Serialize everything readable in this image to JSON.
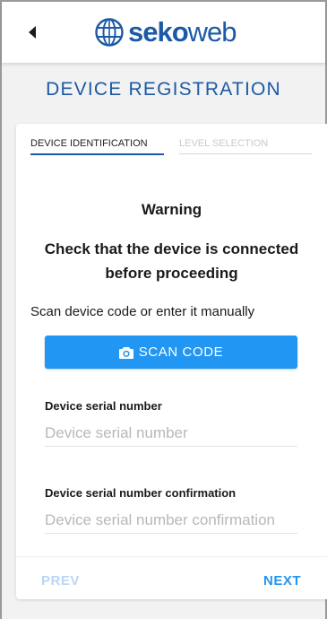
{
  "header": {
    "brand_bold": "seko",
    "brand_light": "web"
  },
  "page": {
    "title": "DEVICE REGISTRATION"
  },
  "tabs": [
    {
      "label": "DEVICE IDENTIFICATION",
      "active": true
    },
    {
      "label": "LEVEL SELECTION",
      "active": false
    }
  ],
  "content": {
    "warning_title": "Warning",
    "warning_text": "Check that the device is connected before proceeding",
    "scan_hint": "Scan device code or enter it manually",
    "scan_button_label": "SCAN CODE",
    "serial_label": "Device serial number",
    "serial_placeholder": "Device serial number",
    "serial_value": "",
    "confirm_label": "Device serial number confirmation",
    "confirm_placeholder": "Device serial number confirmation",
    "confirm_value": ""
  },
  "footer": {
    "prev_label": "PREV",
    "next_label": "NEXT"
  },
  "icons": {
    "back": "back-arrow-icon",
    "logo": "globe-logo-icon",
    "scan": "camera-icon"
  },
  "colors": {
    "brand": "#1c5aa6",
    "primary": "#2196f3",
    "disabled": "#b9d6f3"
  }
}
